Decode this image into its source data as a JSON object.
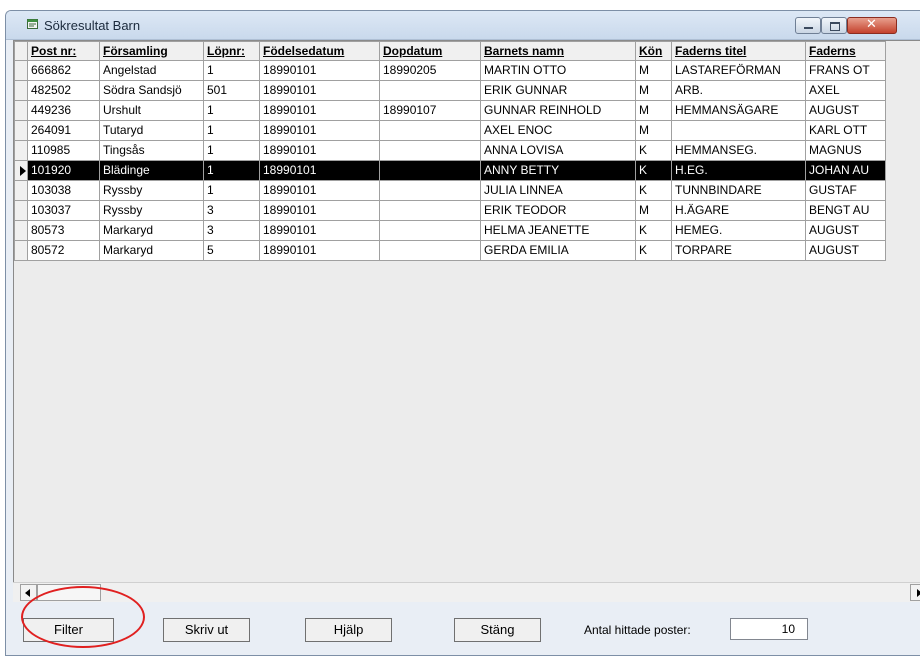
{
  "window": {
    "title": "Sökresultat Barn",
    "close_glyph": "✕",
    "icon": "app-window-icon"
  },
  "grid": {
    "columns": [
      "Post nr:",
      "Församling",
      "Löpnr:",
      "Födelsedatum",
      "Dopdatum",
      "Barnets namn",
      "Kön",
      "Faderns titel",
      "Faderns"
    ],
    "rows": [
      [
        "666862",
        "Angelstad",
        "1",
        "18990101",
        "18990205",
        "MARTIN OTTO",
        "M",
        "LASTAREFÖRMAN",
        "FRANS OT"
      ],
      [
        "482502",
        "Södra Sandsjö",
        "501",
        "18990101",
        "",
        "ERIK GUNNAR",
        "M",
        "ARB.",
        "AXEL"
      ],
      [
        "449236",
        "Urshult",
        "1",
        "18990101",
        "18990107",
        "GUNNAR REINHOLD",
        "M",
        "HEMMANSÄGARE",
        "AUGUST"
      ],
      [
        "264091",
        "Tutaryd",
        "1",
        "18990101",
        "",
        "AXEL ENOC",
        "M",
        "",
        "KARL OTT"
      ],
      [
        "110985",
        "Tingsås",
        "1",
        "18990101",
        "",
        "ANNA LOVISA",
        "K",
        "HEMMANSEG.",
        "MAGNUS"
      ],
      [
        "101920",
        "Blädinge",
        "1",
        "18990101",
        "",
        "ANNY BETTY",
        "K",
        "H.EG.",
        "JOHAN AU"
      ],
      [
        "103038",
        "Ryssby",
        "1",
        "18990101",
        "",
        "JULIA LINNEA",
        "K",
        "TUNNBINDARE",
        "GUSTAF"
      ],
      [
        "103037",
        "Ryssby",
        "3",
        "18990101",
        "",
        "ERIK TEODOR",
        "M",
        "H.ÄGARE",
        "BENGT AU"
      ],
      [
        "80573",
        "Markaryd",
        "3",
        "18990101",
        "",
        "HELMA JEANETTE",
        "K",
        "HEMEG.",
        "AUGUST"
      ],
      [
        "80572",
        "Markaryd",
        "5",
        "18990101",
        "",
        "GERDA EMILIA",
        "K",
        "TORPARE",
        "AUGUST"
      ]
    ],
    "selected_row_index": 5
  },
  "footer": {
    "filter_label": "Filter",
    "print_label": "Skriv ut",
    "help_label": "Hjälp",
    "close_label": "Stäng",
    "count_label": "Antal hittade poster:",
    "count_value": "10"
  },
  "colors": {
    "annotation_circle": "#e02020",
    "selected_row_bg": "#000000",
    "selected_row_fg": "#ffffff"
  }
}
